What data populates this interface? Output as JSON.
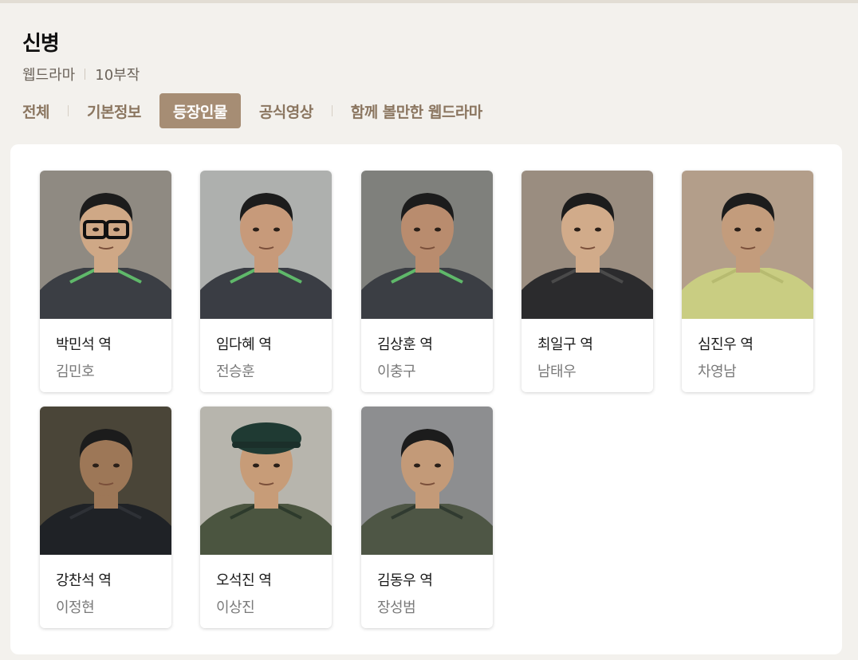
{
  "title": "신병",
  "meta": {
    "category": "웹드라마",
    "episodes": "10부작"
  },
  "tabs": [
    {
      "label": "전체"
    },
    {
      "label": "기본정보"
    },
    {
      "label": "등장인물",
      "active": true
    },
    {
      "label": "공식영상"
    },
    {
      "label": "함께 볼만한 웹드라마"
    }
  ],
  "cast": [
    {
      "role": "박민석 역",
      "actor": "김민호",
      "bg": "#8f8a82",
      "skin": "#cfa886",
      "outfit": "#3b3e44",
      "accent": "#5fb86a",
      "glasses": true
    },
    {
      "role": "임다혜 역",
      "actor": "전승훈",
      "bg": "#aeb0ae",
      "skin": "#c79a7a",
      "outfit": "#3a3d44",
      "accent": "#5fb86a"
    },
    {
      "role": "김상훈 역",
      "actor": "이충구",
      "bg": "#7f807c",
      "skin": "#b98c6e",
      "outfit": "#3b3e44",
      "accent": "#5fb86a"
    },
    {
      "role": "최일구 역",
      "actor": "남태우",
      "bg": "#9a8d80",
      "skin": "#d1ab8a",
      "outfit": "#2b2b2d",
      "accent": "#4a4a4a"
    },
    {
      "role": "심진우 역",
      "actor": "차영남",
      "bg": "#b39e8a",
      "skin": "#c39c7c",
      "outfit": "#c9cd82",
      "accent": "#b7bb70"
    },
    {
      "role": "강찬석 역",
      "actor": "이정현",
      "bg": "#4a4538",
      "skin": "#9d7757",
      "outfit": "#1f2226",
      "accent": "#2e3136"
    },
    {
      "role": "오석진 역",
      "actor": "이상진",
      "bg": "#b7b5ad",
      "skin": "#c79c78",
      "outfit": "#4b5540",
      "accent": "#2d3a2c",
      "beret": true
    },
    {
      "role": "김동우 역",
      "actor": "장성범",
      "bg": "#8d8e90",
      "skin": "#c39a78",
      "outfit": "#4e5645",
      "accent": "#303a30"
    }
  ]
}
